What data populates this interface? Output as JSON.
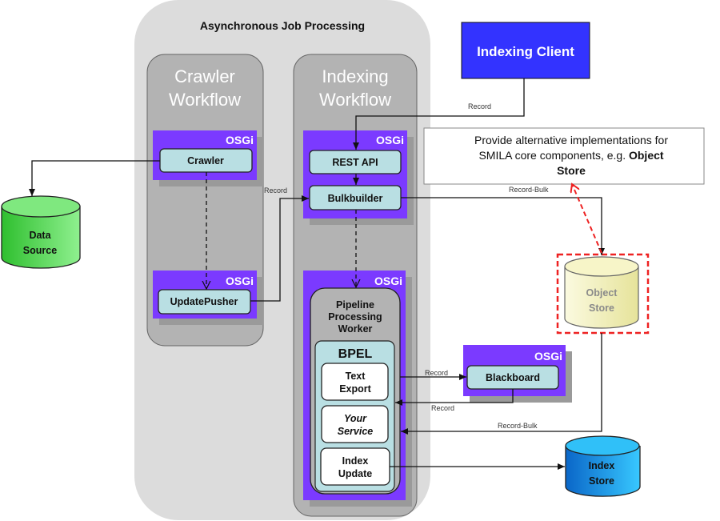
{
  "title": "Asynchronous Job Processing",
  "lanes": {
    "crawler": {
      "line1": "Crawler",
      "line2": "Workflow"
    },
    "indexing": {
      "line1": "Indexing",
      "line2": "Workflow"
    }
  },
  "osgi_label": "OSGi",
  "nodes": {
    "crawler": "Crawler",
    "update_pusher": "UpdatePusher",
    "rest_api": "REST API",
    "bulkbuilder": "Bulkbuilder",
    "pipeline_worker": [
      "Pipeline",
      "Processing",
      "Worker"
    ],
    "bpel": "BPEL",
    "text_export": [
      "Text",
      "Export"
    ],
    "your_service": [
      "Your",
      "Service"
    ],
    "index_update": [
      "Index",
      "Update"
    ],
    "blackboard": "Blackboard",
    "indexing_client": "Indexing Client",
    "data_source": [
      "Data",
      "Source"
    ],
    "object_store": [
      "Object",
      "Store"
    ],
    "index_store": [
      "Index",
      "Store"
    ]
  },
  "note": {
    "line1": "Provide alternative implementations for",
    "line2_prefix": "SMILA core components, e.g. ",
    "line2_bold": "Object",
    "line3_bold": "Store"
  },
  "edge_labels": {
    "client_record": "Record",
    "pusher_record": "Record",
    "bulk_record_bulk": "Record-Bulk",
    "to_blackboard": "Record",
    "from_blackboard": "Record",
    "store_record_bulk": "Record-Bulk"
  },
  "colors": {
    "osgi": "#7b3aff",
    "node": "#b9dfe3",
    "indexing_client": "#3333ff",
    "data_source": "#66dd66",
    "object_store": "#f2f0b8",
    "index_store": "#1a8fe0",
    "highlight": "#ee2222"
  }
}
